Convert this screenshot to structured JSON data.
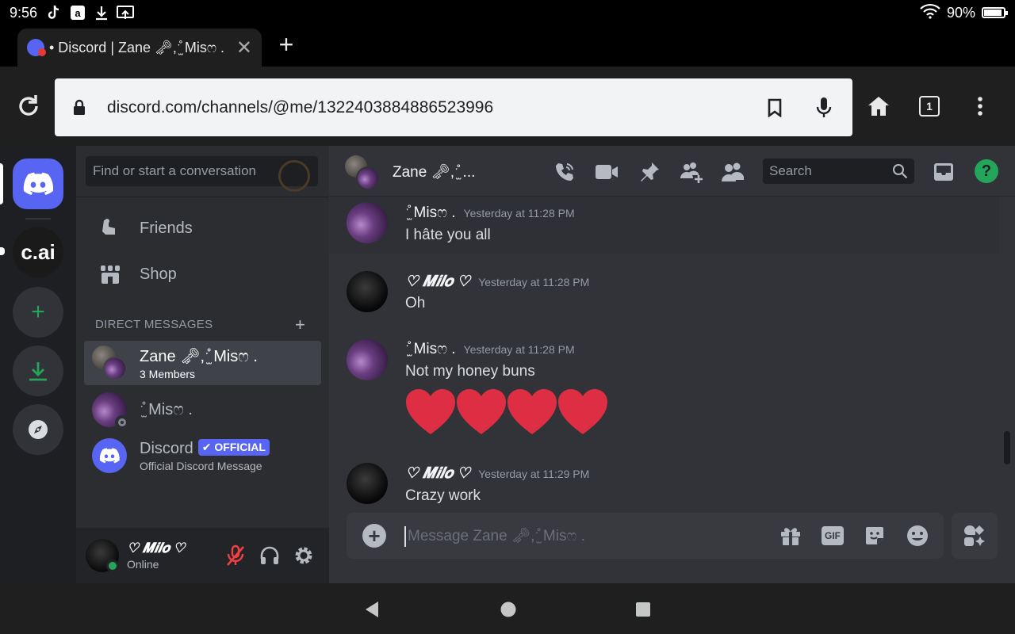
{
  "status_bar": {
    "time": "9:56",
    "battery": "90%",
    "battery_level": 0.9
  },
  "tab": {
    "title": "• Discord | Zane 🗝,ˑ̫̊ Misෆ .",
    "close_label": "✕"
  },
  "newtab_label": "+",
  "toolbar": {
    "url": "discord.com/channels/@me/1322403884886523996",
    "tab_count": "1"
  },
  "guilds": {
    "cai_label": "c.ai",
    "add_label": "+"
  },
  "dm_sidebar": {
    "search_placeholder": "Find or start a conversation",
    "nav": [
      {
        "label": "Friends",
        "icon": "friends-icon"
      },
      {
        "label": "Shop",
        "icon": "shop-icon"
      }
    ],
    "section_title": "DIRECT MESSAGES",
    "section_add": "+",
    "dms": [
      {
        "name": "Zane 🗝,ˑ̫̊ Misෆ .",
        "sub": "3 Members"
      },
      {
        "name": "ˑ̫̊ Misෆ .",
        "sub": ""
      },
      {
        "name": "Discord",
        "badge": "✔ OFFICIAL",
        "sub": "Official Discord Message"
      }
    ]
  },
  "user_panel": {
    "name": "♡ 𝑴𝒊𝒍𝒐 ♡",
    "status": "Online"
  },
  "chat": {
    "title": "Zane 🗝,ˑ̫̊ ...",
    "search_placeholder": "Search",
    "help_label": "?",
    "messages": [
      {
        "author": "ˑ̫̊ Misෆ .",
        "time": "Yesterday at 11:28 PM",
        "text": "I hâte you all"
      },
      {
        "author": "♡ 𝑴𝒊𝒍𝒐 ♡",
        "time": "Yesterday at 11:28 PM",
        "text": "Oh"
      },
      {
        "author": "ˑ̫̊ Misෆ .",
        "time": "Yesterday at 11:28 PM",
        "text": "Not my honey buns"
      },
      {
        "author": "♡ 𝑴𝒊𝒍𝒐 ♡",
        "time": "Yesterday at 11:29 PM",
        "text": "Crazy work"
      }
    ],
    "heart_count": 4,
    "composer_placeholder": "Message Zane 🗝,ˑ̫̊ Misෆ .",
    "gif_label": "GIF"
  },
  "colors": {
    "blurple": "#5865f2",
    "green": "#23a55a",
    "heart": "#dd2e44",
    "background": "#313338"
  }
}
